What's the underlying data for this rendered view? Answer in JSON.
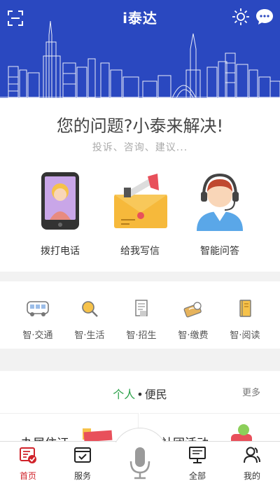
{
  "header": {
    "title": "i泰达",
    "icons": [
      "scan-icon",
      "sun-icon",
      "chat-icon"
    ],
    "background": "#2a48c0"
  },
  "hero": {
    "title": "您的问题?小泰来解决!",
    "subtitle": "投诉、咨询、建议...",
    "actions": [
      {
        "label": "拨打电话",
        "icon": "phone-illustration"
      },
      {
        "label": "给我写信",
        "icon": "letter-illustration"
      },
      {
        "label": "智能问答",
        "icon": "assistant-illustration"
      }
    ]
  },
  "quick_services": [
    {
      "label": "智·交通",
      "icon": "bus-icon"
    },
    {
      "label": "智·生活",
      "icon": "magnifier-icon"
    },
    {
      "label": "智·招生",
      "icon": "document-icon"
    },
    {
      "label": "智·缴费",
      "icon": "payment-icon"
    },
    {
      "label": "智·阅读",
      "icon": "book-icon"
    }
  ],
  "section": {
    "title_primary": "个人",
    "title_separator": "•",
    "title_secondary": "便民",
    "more": "更多",
    "accent": "#2ca24a"
  },
  "cards": [
    {
      "title": "办居住证"
    },
    {
      "title": "社团活动"
    }
  ],
  "tabbar": {
    "active_color": "#d0232b",
    "tabs": [
      {
        "label": "首页",
        "icon": "home-icon"
      },
      {
        "label": "服务",
        "icon": "service-icon"
      },
      {
        "label": "",
        "icon": "microphone-icon"
      },
      {
        "label": "全部",
        "icon": "monitor-icon"
      },
      {
        "label": "我的",
        "icon": "user-icon"
      }
    ]
  }
}
